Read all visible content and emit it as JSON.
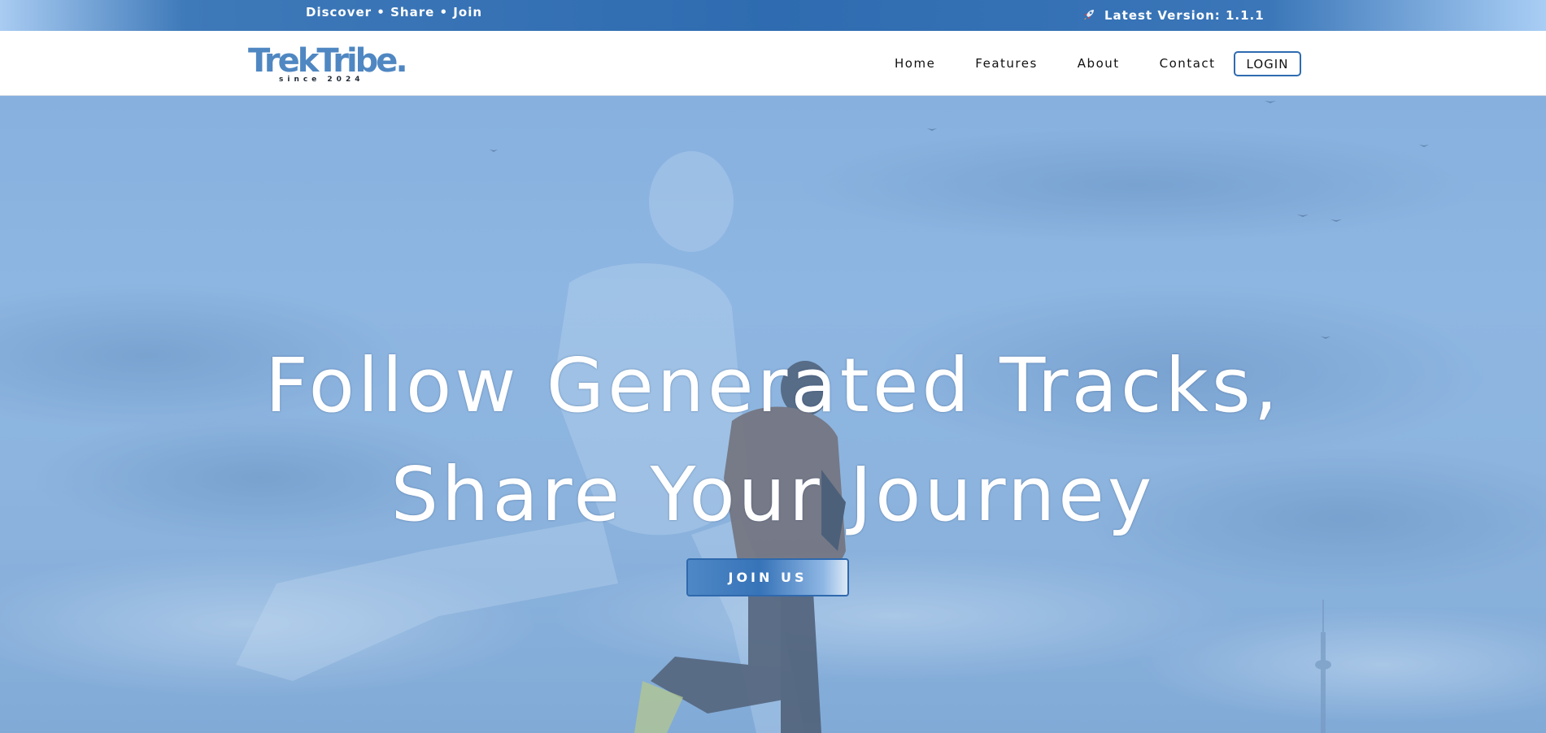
{
  "topbar": {
    "tagline": "Discover • Share • Join",
    "version_label": "Latest Version: 1.1.1",
    "version_icon": "rocket-icon"
  },
  "navbar": {
    "logo_text": "TrekTribe.",
    "logo_subtext": "since 2024",
    "links": [
      {
        "label": "Home"
      },
      {
        "label": "Features"
      },
      {
        "label": "About"
      },
      {
        "label": "Contact"
      }
    ],
    "login_label": "LOGIN"
  },
  "hero": {
    "title_line1": "Follow Generated Tracks,",
    "title_line2": "Share Your Journey",
    "cta_label": "JOIN US"
  },
  "colors": {
    "brand_blue": "#2e6bb0",
    "logo_blue": "#4f87c2",
    "hero_tint": "#8fb6e2"
  }
}
